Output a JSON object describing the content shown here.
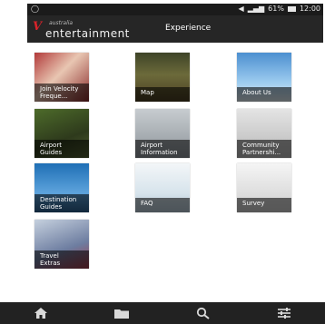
{
  "status_bar": {
    "left_icon": "notification-icon",
    "battery": "61%",
    "time": "12:00"
  },
  "app_bar": {
    "brand_small": "australia",
    "brand": "entertainment",
    "title": "Experience"
  },
  "tiles": [
    {
      "label": "Join Velocity\nFreque..."
    },
    {
      "label": "Map"
    },
    {
      "label": "About Us"
    },
    {
      "label": "Airport\nGuides"
    },
    {
      "label": "Airport\nInformation"
    },
    {
      "label": "Community\nPartnershi..."
    },
    {
      "label": "Destination\nGuides"
    },
    {
      "label": "FAQ"
    },
    {
      "label": "Survey"
    },
    {
      "label": "Travel\nExtras"
    }
  ],
  "bottom_nav": [
    {
      "icon": "home-icon"
    },
    {
      "icon": "folder-icon"
    },
    {
      "icon": "search-icon"
    },
    {
      "icon": "settings-sliders-icon"
    }
  ],
  "colors": {
    "app_bar": "#262626",
    "brand_red": "#d8232a",
    "nav_bar": "#222222"
  }
}
